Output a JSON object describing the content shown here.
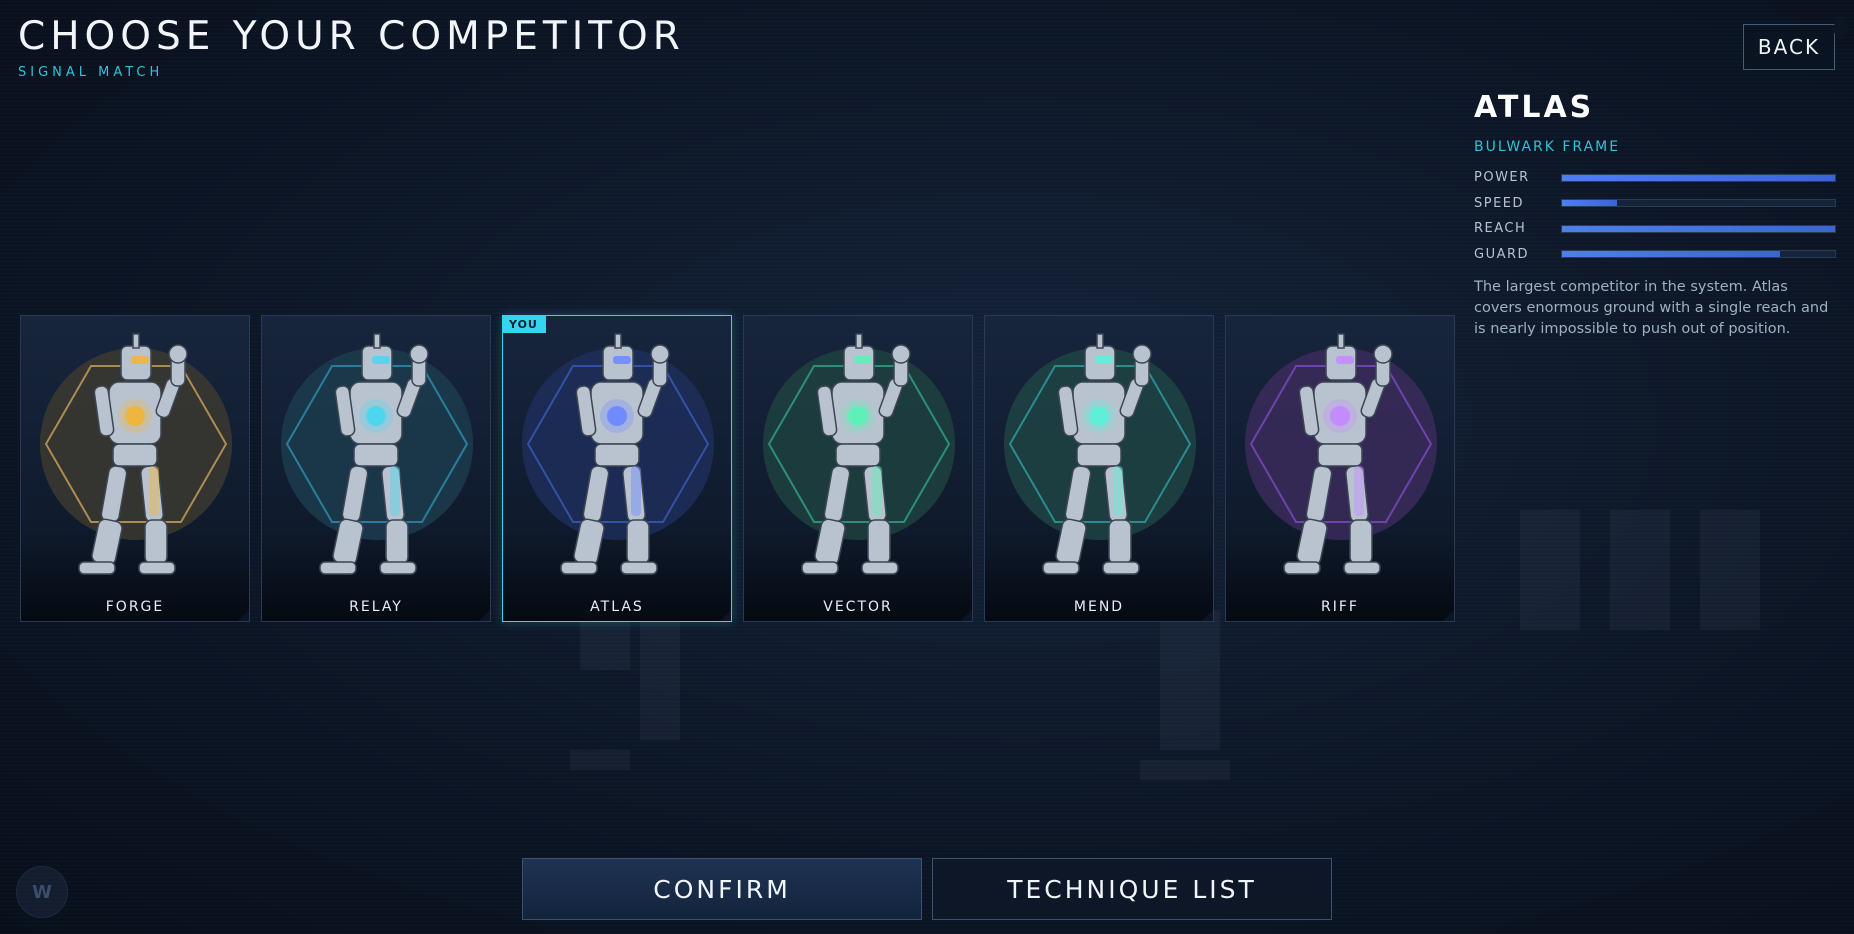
{
  "header": {
    "title": "CHOOSE YOUR COMPETITOR",
    "subtitle": "SIGNAL MATCH"
  },
  "back_label": "BACK",
  "selected": {
    "name": "ATLAS",
    "frame": "BULWARK FRAME",
    "stats": [
      {
        "label": "POWER",
        "value": 1.0
      },
      {
        "label": "SPEED",
        "value": 0.2
      },
      {
        "label": "REACH",
        "value": 1.0
      },
      {
        "label": "GUARD",
        "value": 0.8
      }
    ],
    "description": "The largest competitor in the system. Atlas covers enormous ground with a single reach and is nearly impossible to push out of position."
  },
  "competitors": [
    {
      "name": "FORGE",
      "accent": "#c9a25a",
      "glow": "#f0b640",
      "bg": "#3b3a30"
    },
    {
      "name": "RELAY",
      "accent": "#2f8fb0",
      "glow": "#4fd6f0",
      "bg": "#1c3c4e"
    },
    {
      "name": "ATLAS",
      "accent": "#3b5bb8",
      "glow": "#6f8cff",
      "bg": "#1d2e5a",
      "badge": "YOU"
    },
    {
      "name": "VECTOR",
      "accent": "#2fa58a",
      "glow": "#5ff0b8",
      "bg": "#1f4140"
    },
    {
      "name": "MEND",
      "accent": "#2fa0a0",
      "glow": "#5ff0d8",
      "bg": "#1f4444"
    },
    {
      "name": "RIFF",
      "accent": "#7a4bc0",
      "glow": "#c58cff",
      "bg": "#3a2b5a"
    }
  ],
  "buttons": {
    "confirm": "CONFIRM",
    "technique": "TECHNIQUE LIST"
  },
  "corner_logo": "W"
}
